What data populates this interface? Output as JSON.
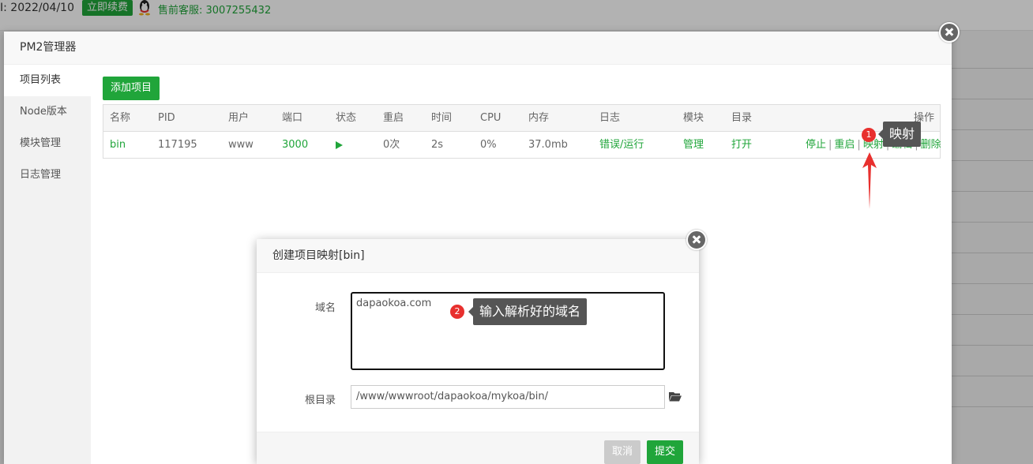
{
  "background": {
    "expire_label": "I: 2022/04/10",
    "renew_button": "立即续费",
    "support": "售前客服: 3007255432"
  },
  "pm2": {
    "title": "PM2管理器",
    "sidebar": [
      {
        "label": "项目列表"
      },
      {
        "label": "Node版本"
      },
      {
        "label": "模块管理"
      },
      {
        "label": "日志管理"
      }
    ],
    "add_button": "添加项目",
    "columns": [
      "名称",
      "PID",
      "用户",
      "端口",
      "状态",
      "重启",
      "时间",
      "CPU",
      "内存",
      "日志",
      "模块",
      "目录",
      "操作"
    ],
    "row": {
      "name": "bin",
      "pid": "117195",
      "user": "www",
      "port": "3000",
      "status": "running",
      "restarts": "0次",
      "time": "2s",
      "cpu": "0%",
      "memory": "37.0mb",
      "log": "错误/运行",
      "module": "管理",
      "dir": "打开",
      "actions": [
        "停止",
        "重启",
        "映射",
        "编辑",
        "删除"
      ]
    }
  },
  "annotations": {
    "step1_number": "1",
    "step1_text": "映射",
    "step2_number": "2",
    "step2_text": "输入解析好的域名"
  },
  "dialog": {
    "title": "创建项目映射[bin]",
    "domain_label": "域名",
    "domain_value": "dapaokoa.com",
    "root_label": "根目录",
    "root_value": "/www/wwwroot/dapaokoa/mykoa/bin/",
    "cancel": "取消",
    "submit": "提交"
  },
  "colors": {
    "accent": "#20a53a",
    "badge": "#e8302e",
    "tooltip": "#555555"
  }
}
